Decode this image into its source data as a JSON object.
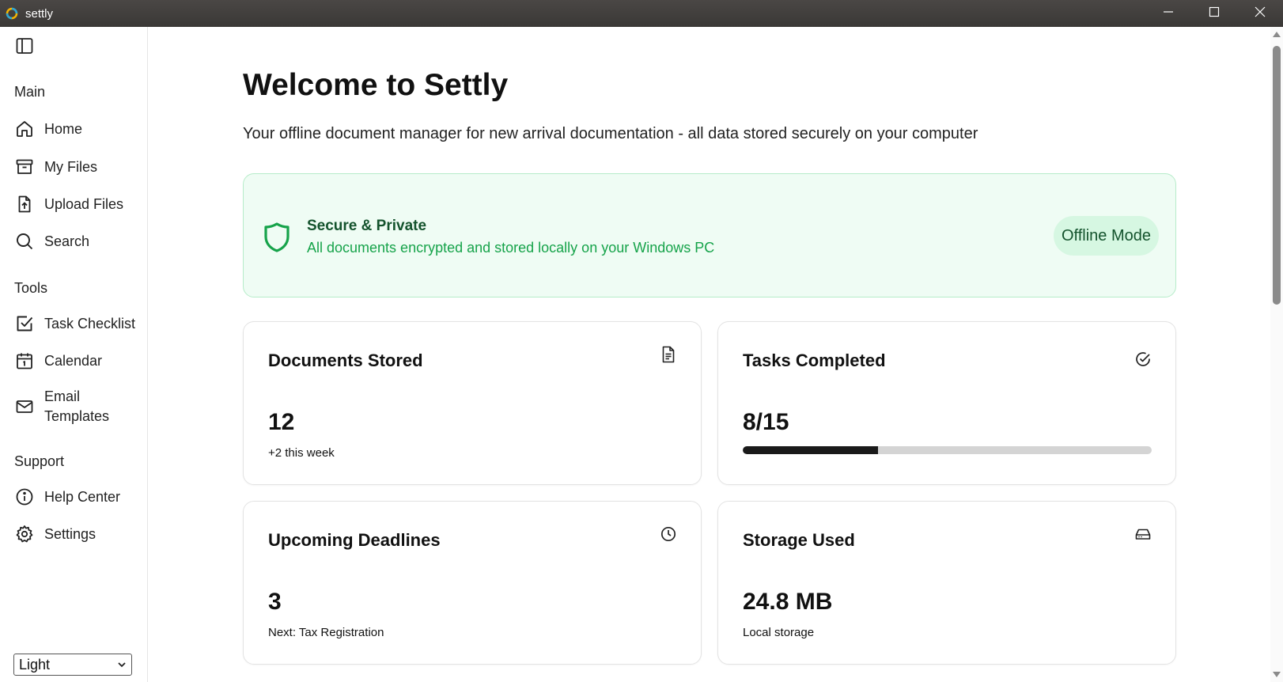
{
  "window": {
    "title": "settly",
    "controls": [
      "minimize-icon",
      "maximize-icon",
      "close-icon"
    ]
  },
  "sidebar": {
    "sections": [
      {
        "label": "Main",
        "items": [
          {
            "label": "Home",
            "icon": "home-icon"
          },
          {
            "label": "My Files",
            "icon": "archive-icon"
          },
          {
            "label": "Upload Files",
            "icon": "file-upload-icon"
          },
          {
            "label": "Search",
            "icon": "search-icon"
          }
        ]
      },
      {
        "label": "Tools",
        "items": [
          {
            "label": "Task Checklist",
            "icon": "checkbox-icon"
          },
          {
            "label": "Calendar",
            "icon": "calendar-icon"
          },
          {
            "label": "Email Templates",
            "icon": "mail-icon"
          }
        ]
      },
      {
        "label": "Support",
        "items": [
          {
            "label": "Help Center",
            "icon": "info-icon"
          },
          {
            "label": "Settings",
            "icon": "gear-icon"
          }
        ]
      }
    ],
    "theme": {
      "selected": "Light"
    }
  },
  "main": {
    "title": "Welcome to Settly",
    "subtitle": "Your offline document manager for new arrival documentation - all data stored securely on your computer",
    "banner": {
      "title": "Secure & Private",
      "text": "All documents encrypted and stored locally on your Windows PC",
      "badge": "Offline Mode",
      "icon": "shield-icon"
    },
    "cards": [
      {
        "title": "Documents Stored",
        "value": "12",
        "sub": "+2 this week",
        "icon": "document-icon"
      },
      {
        "title": "Tasks Completed",
        "value": "8/15",
        "progress": 0.33,
        "icon": "check-circle-icon"
      },
      {
        "title": "Upcoming Deadlines",
        "value": "3",
        "sub": "Next: Tax Registration",
        "icon": "clock-icon"
      },
      {
        "title": "Storage Used",
        "value": "24.8 MB",
        "sub": "Local storage",
        "icon": "hard-drive-icon"
      }
    ]
  },
  "colors": {
    "accent_green": "#16a34a",
    "banner_bg": "#effcf4",
    "badge_bg": "#d6f7e2",
    "progress_fill": "#1a1a1a"
  }
}
